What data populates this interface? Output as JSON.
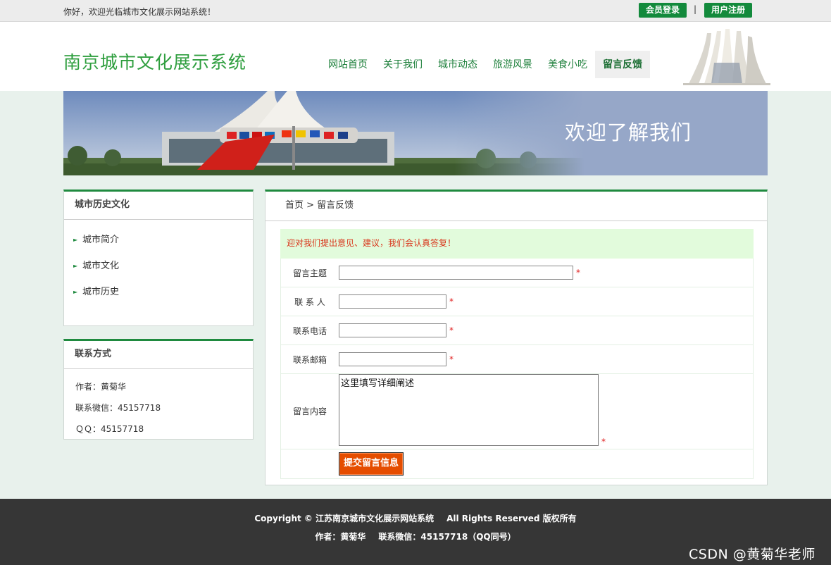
{
  "topbar": {
    "welcome": "你好，欢迎光临城市文化展示网站系统！",
    "login_label": "会员登录",
    "separator": "|",
    "register_label": "用户注册"
  },
  "header": {
    "site_title": "南京城市文化展示系统",
    "nav": [
      {
        "label": "网站首页"
      },
      {
        "label": "关于我们"
      },
      {
        "label": "城市动态"
      },
      {
        "label": "旅游风景"
      },
      {
        "label": "美食小吃"
      },
      {
        "label": "留言反馈",
        "active": true
      }
    ]
  },
  "banner": {
    "caption": "欢迎了解我们"
  },
  "sidebar": {
    "history": {
      "title": "城市历史文化",
      "items": [
        {
          "label": "城市简介"
        },
        {
          "label": "城市文化"
        },
        {
          "label": "城市历史"
        }
      ]
    },
    "contact": {
      "title": "联系方式",
      "author": "作者：黄菊华",
      "wechat": "联系微信：45157718",
      "qq": "ＱＱ：45157718"
    }
  },
  "main": {
    "breadcrumb": "首页 > 留言反馈",
    "notice": "迎对我们提出意见、建议，我们会认真答复！",
    "form": {
      "subject_label": "留言主题",
      "contact_label": "联 系 人",
      "phone_label": "联系电话",
      "email_label": "联系邮箱",
      "content_label": "留言内容",
      "content_value": "这里填写详细阐述",
      "required_mark": "*",
      "submit_label": "提交留言信息"
    }
  },
  "footer": {
    "copyright": "Copyright © 江苏南京城市文化展示网站系统",
    "rights": "All Rights Reserved 版权所有",
    "author": "作者：黄菊华",
    "wechat": "联系微信：45157718（QQ同号）",
    "watermark": "CSDN @黄菊华老师"
  },
  "colors": {
    "brand_green": "#1f8a3f",
    "button_orange": "#e54d00",
    "notice_bg": "#e2fbdc",
    "notice_text": "#d9361b",
    "footer_bg": "#363636"
  }
}
